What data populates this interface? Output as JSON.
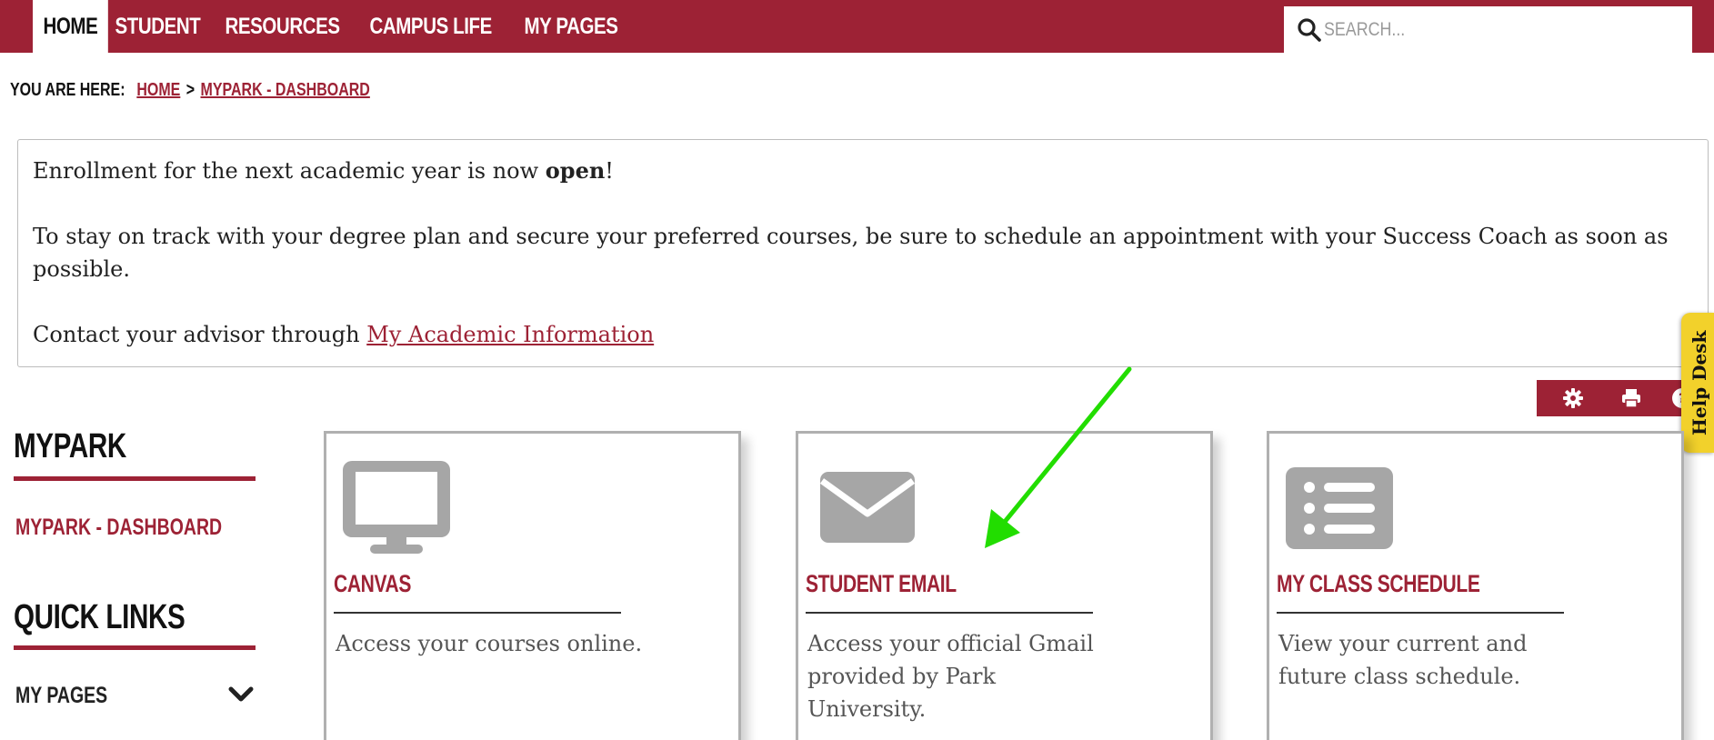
{
  "nav": {
    "items": [
      {
        "label": "HOME",
        "active": true
      },
      {
        "label": "STUDENT"
      },
      {
        "label": "RESOURCES"
      },
      {
        "label": "CAMPUS LIFE"
      },
      {
        "label": "MY PAGES"
      }
    ],
    "search_placeholder": "SEARCH..."
  },
  "breadcrumb": {
    "label": "YOU ARE HERE:",
    "items": [
      "HOME",
      "MYPARK - DASHBOARD"
    ],
    "separator": ">"
  },
  "announcement": {
    "line1_pre": "Enrollment for the next academic year is now ",
    "line1_bold": "open",
    "line1_post": "!",
    "line2": "To stay on track with your degree plan and secure your preferred courses, be sure to schedule an appointment with your Success Coach as soon as possible.",
    "line3_pre": "Contact your advisor through ",
    "line3_link": "My Academic Information"
  },
  "toolbar": {
    "icons": [
      "gear-icon",
      "print-icon",
      "help-icon"
    ]
  },
  "helpdesk": {
    "label": "Help Desk"
  },
  "sidebar": {
    "mypark_heading": "MYPARK",
    "dashboard_link": "MYPARK - DASHBOARD",
    "quicklinks_heading": "QUICK LINKS",
    "my_pages": "MY PAGES"
  },
  "cards": [
    {
      "icon": "monitor-icon",
      "title": "CANVAS",
      "desc": "Access your courses online."
    },
    {
      "icon": "envelope-icon",
      "title": "STUDENT EMAIL",
      "desc": "Access your official Gmail provided by Park University."
    },
    {
      "icon": "list-icon",
      "title": "MY CLASS SCHEDULE",
      "desc": "View your current and future class schedule."
    }
  ],
  "colors": {
    "brand": "#9d2235",
    "card_border": "#b0b0b0",
    "icon_gray": "#a6a6a6",
    "helpdesk": "#f2d12b",
    "arrow": "#22dd00"
  }
}
